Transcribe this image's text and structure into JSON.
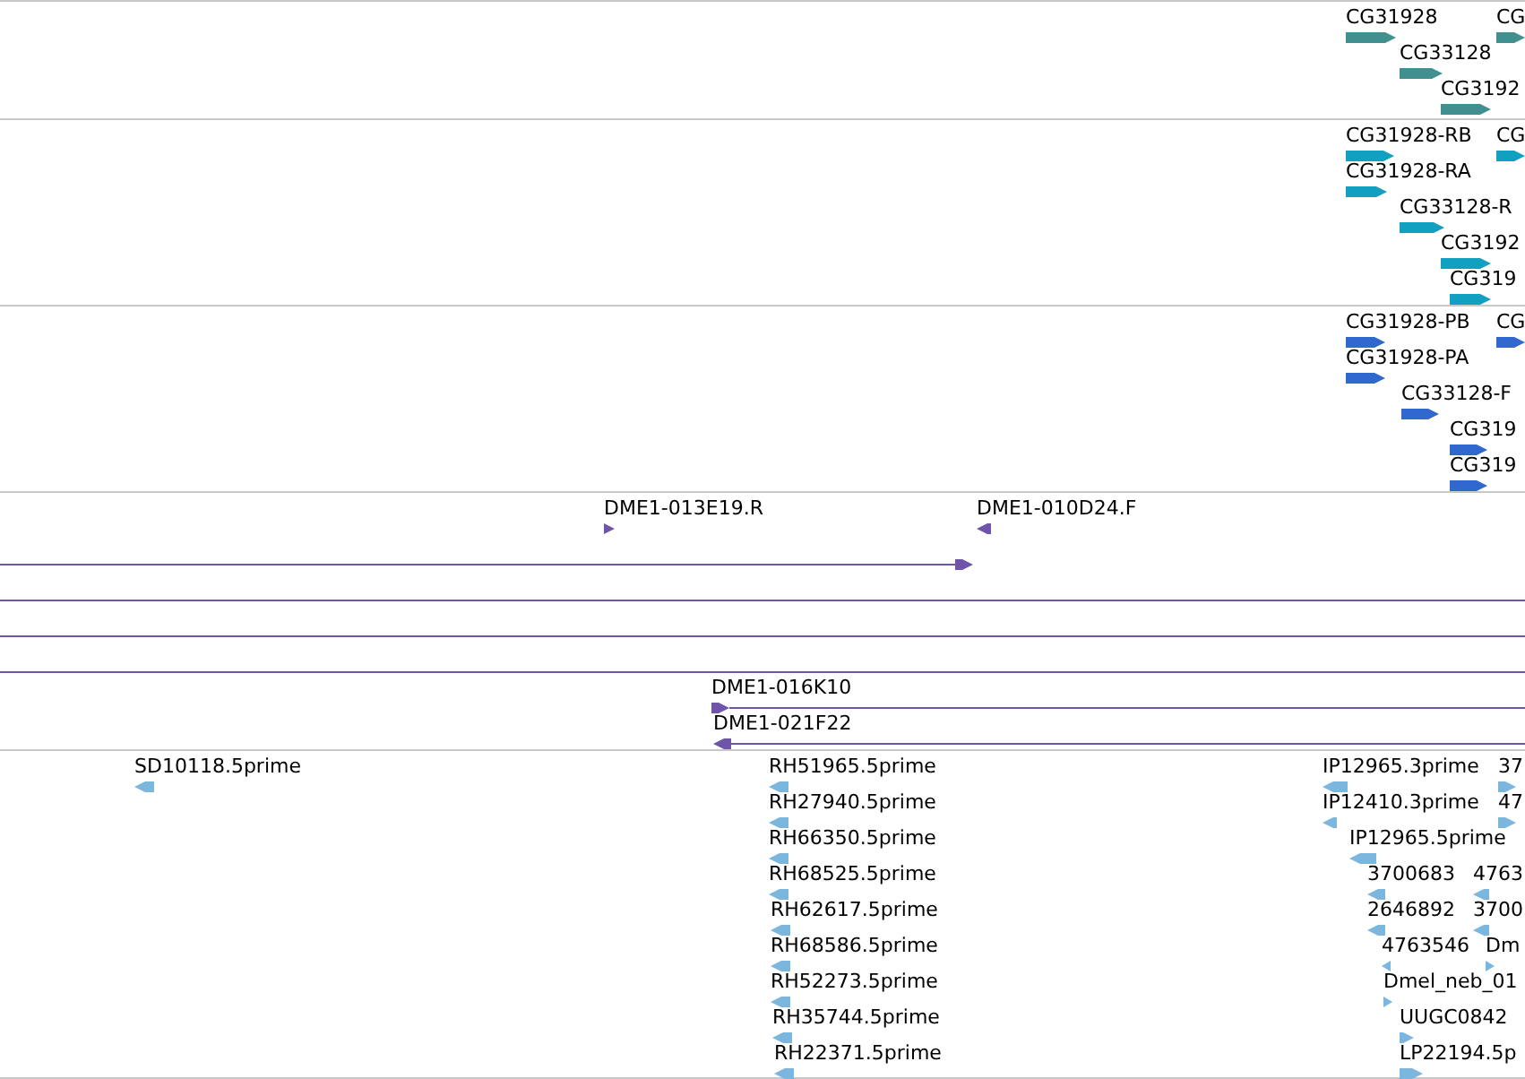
{
  "tracks": [
    {
      "color": "#428f90",
      "features": [
        {
          "label": "CG31928",
          "reverse": false
        },
        {
          "label": "CG",
          "reverse": false
        },
        {
          "label": "CG33128",
          "reverse": false
        },
        {
          "label": "CG3192",
          "reverse": false
        }
      ]
    },
    {
      "color": "#12a0c0",
      "features": [
        {
          "label": "CG31928-RB",
          "reverse": false
        },
        {
          "label": "CG",
          "reverse": false
        },
        {
          "label": "CG31928-RA",
          "reverse": false
        },
        {
          "label": "CG33128-R",
          "reverse": false
        },
        {
          "label": "CG3192",
          "reverse": false
        },
        {
          "label": "CG319",
          "reverse": false
        }
      ]
    },
    {
      "color": "#3068d0",
      "features": [
        {
          "label": "CG31928-PB",
          "reverse": false
        },
        {
          "label": "CG",
          "reverse": false
        },
        {
          "label": "CG31928-PA",
          "reverse": false
        },
        {
          "label": "CG33128-F",
          "reverse": false
        },
        {
          "label": "CG319",
          "reverse": false
        },
        {
          "label": "CG319",
          "reverse": false
        }
      ]
    },
    {
      "color": "#6e55a8",
      "features": [
        {
          "label": "DME1-013E19.R",
          "reverse": false
        },
        {
          "label": "DME1-010D24.F",
          "reverse": true
        },
        {
          "kind": "line",
          "reverse": false
        },
        {
          "kind": "span"
        },
        {
          "kind": "span"
        },
        {
          "kind": "span"
        },
        {
          "label": "DME1-016K10",
          "kind": "line",
          "reverse": false
        },
        {
          "label": "DME1-021F22",
          "kind": "line",
          "reverse": true
        }
      ]
    },
    {
      "color": "#7ab6de",
      "features": [
        {
          "label": "SD10118.5prime",
          "reverse": true
        },
        {
          "label": "RH51965.5prime",
          "reverse": true
        },
        {
          "label": "IP12965.3prime",
          "reverse": true
        },
        {
          "label": "37",
          "reverse": false
        },
        {
          "label": "RH27940.5prime",
          "reverse": true
        },
        {
          "label": "IP12410.3prime",
          "reverse": true
        },
        {
          "label": "47",
          "reverse": false
        },
        {
          "label": "RH66350.5prime",
          "reverse": true
        },
        {
          "label": "IP12965.5prime",
          "reverse": true
        },
        {
          "label": "RH68525.5prime",
          "reverse": true
        },
        {
          "label": "3700683",
          "reverse": true
        },
        {
          "label": "4763",
          "reverse": true
        },
        {
          "label": "RH62617.5prime",
          "reverse": true
        },
        {
          "label": "2646892",
          "reverse": true
        },
        {
          "label": "3700",
          "reverse": true
        },
        {
          "label": "RH68586.5prime",
          "reverse": true
        },
        {
          "label": "4763546",
          "reverse": true
        },
        {
          "label": "Dm",
          "reverse": false
        },
        {
          "label": "RH52273.5prime",
          "reverse": true
        },
        {
          "label": "Dmel_neb_01",
          "reverse": false
        },
        {
          "label": "RH35744.5prime",
          "reverse": true
        },
        {
          "label": "UUGC0842",
          "reverse": false
        },
        {
          "label": "RH22371.5prime",
          "reverse": true
        },
        {
          "label": "LP22194.5p",
          "reverse": false
        }
      ]
    }
  ]
}
